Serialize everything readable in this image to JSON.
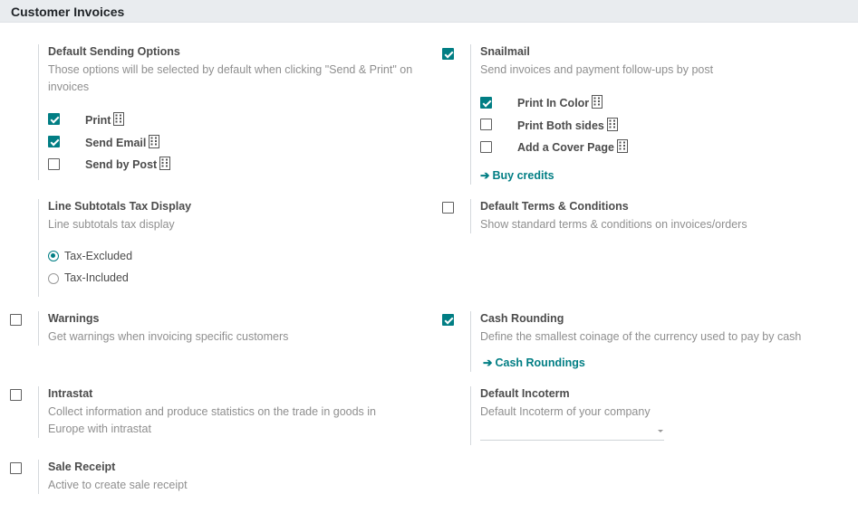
{
  "section": {
    "title": "Customer Invoices"
  },
  "default_sending": {
    "title": "Default Sending Options",
    "description": "Those options will be selected by default when clicking \"Send & Print\" on invoices",
    "options": [
      {
        "label": "Print",
        "checked": true
      },
      {
        "label": "Send Email",
        "checked": true
      },
      {
        "label": "Send by Post",
        "checked": false
      }
    ]
  },
  "snailmail": {
    "checked": true,
    "title": "Snailmail",
    "description": "Send invoices and payment follow-ups by post",
    "options": [
      {
        "label": "Print In Color",
        "checked": true
      },
      {
        "label": "Print Both sides",
        "checked": false
      },
      {
        "label": "Add a Cover Page",
        "checked": false
      }
    ],
    "link": "Buy credits"
  },
  "line_subtotals": {
    "title": "Line Subtotals Tax Display",
    "description": "Line subtotals tax display",
    "options": [
      {
        "label": "Tax-Excluded",
        "selected": true
      },
      {
        "label": "Tax-Included",
        "selected": false
      }
    ]
  },
  "default_terms": {
    "checked": false,
    "title": "Default Terms & Conditions",
    "description": "Show standard terms & conditions on invoices/orders"
  },
  "warnings": {
    "checked": false,
    "title": "Warnings",
    "description": "Get warnings when invoicing specific customers"
  },
  "cash_rounding": {
    "checked": true,
    "title": "Cash Rounding",
    "description": "Define the smallest coinage of the currency used to pay by cash",
    "link": "Cash Roundings"
  },
  "intrastat": {
    "checked": false,
    "title": "Intrastat",
    "description_line1": "Collect information and produce statistics on the trade in goods in",
    "description_line2": "Europe with intrastat"
  },
  "default_incoterm": {
    "title": "Default Incoterm",
    "description": "Default Incoterm of your company",
    "value": ""
  },
  "sale_receipt": {
    "checked": false,
    "title": "Sale Receipt",
    "description": "Active to create sale receipt"
  },
  "colors": {
    "accent": "#017e84",
    "muted_text": "#8f8f8f",
    "header_bg": "#e9ecef"
  },
  "icons": {
    "company": "building-icon",
    "arrow": "arrow-right-icon"
  }
}
